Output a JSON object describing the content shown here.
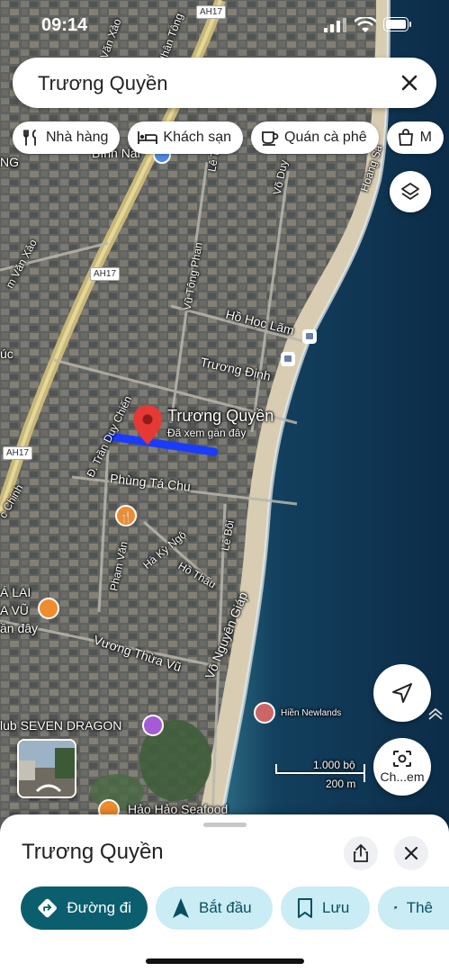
{
  "status_bar": {
    "time": "09:14"
  },
  "search": {
    "query": "Trương Quyền"
  },
  "chips": [
    {
      "label": "Nhà hàng",
      "icon": "fork-knife-icon"
    },
    {
      "label": "Khách sạn",
      "icon": "bed-icon"
    },
    {
      "label": "Quán cà phê",
      "icon": "coffee-cup-icon"
    },
    {
      "label": "M",
      "icon": "shopping-bag-icon"
    }
  ],
  "map": {
    "streets": {
      "truong_dinh": "Trương Định",
      "ho_hoc_lam": "Hồ Học Lãm",
      "vu_tong_phan": "Vũ Tông Phan",
      "tran_duy_chien": "Đ. Trần Duy Chiến",
      "phung_ta_chu": "Phùng Tá Chu",
      "ha_ky_ngo": "Hà Kỳ Ngộ",
      "ho_thau": "Hồ Thấu",
      "le_boi": "Lê Bôi",
      "pham_van": "Phạm Văn",
      "vuong_thua_vu": "Vương Thừa Vũ",
      "vo_nguyen_giap": "Võ Nguyên Giáp",
      "hoang_sa": "Hoàng Sa",
      "vo_duy": "Võ Duy",
      "le_tu": "Lê Tư",
      "m_van_xao": "m Văn Xảo",
      "c_chinh": "c Chinh",
      "nhan_tong": "Nhân Tông",
      "van_xao_top": "Văn Xảo"
    },
    "highway_badges": [
      "AH17",
      "AH17",
      "AH17"
    ],
    "pin": {
      "title": "Trương Quyền",
      "subtitle": "Đã xem gần đây"
    },
    "places": {
      "seven_dragon": "lub SEVEN DRAGON",
      "hao_hao": "Hảo Hảo Seafood",
      "a_lai": "Á LAI",
      "a_vu": "A VŨ",
      "an_day": "ần đây",
      "binh_nai": "Bình Nai",
      "ng": "NG",
      "uc": "úc",
      "hien_newlands": "Hiền Newlands"
    },
    "scale": {
      "top": "1.000 bộ",
      "bottom": "200 m"
    },
    "lens_label": "Ch...em"
  },
  "sheet": {
    "place_name": "Trương Quyền",
    "actions": [
      {
        "label": "Đường đi",
        "icon": "directions-icon"
      },
      {
        "label": "Bắt đầu",
        "icon": "navigation-arrow-icon"
      },
      {
        "label": "Lưu",
        "icon": "bookmark-icon"
      },
      {
        "label": "Thê",
        "icon": "flag-icon"
      }
    ]
  },
  "colors": {
    "accent": "#0b5e6e",
    "secondary_bg": "#c9ecf5",
    "pin": "#e53935",
    "route": "#1a3cff",
    "sea": "#123a55"
  }
}
